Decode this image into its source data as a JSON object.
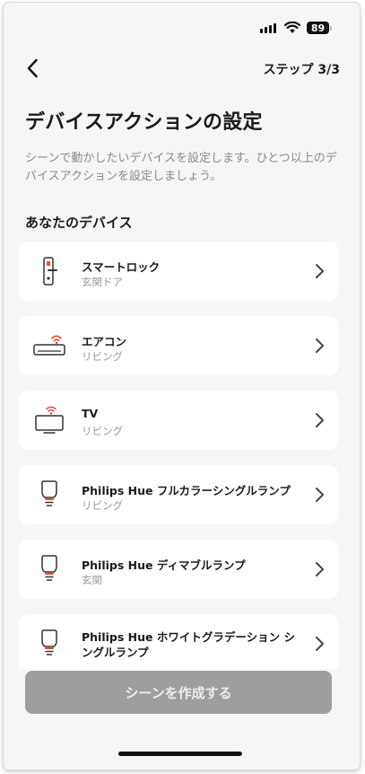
{
  "status_bar": {
    "battery_level": "89"
  },
  "header": {
    "step_label": "ステップ 3/3"
  },
  "page": {
    "title": "デバイスアクションの設定",
    "description": "シーンで動かしたいデバイスを設定します。ひとつ以上のデバイスアクションを設定しましょう。",
    "section_title": "あなたのデバイス"
  },
  "devices": [
    {
      "name": "スマートロック",
      "room": "玄関ドア",
      "icon": "smart-lock-icon"
    },
    {
      "name": "エアコン",
      "room": "リビング",
      "icon": "air-conditioner-icon"
    },
    {
      "name": "TV",
      "room": "リビング",
      "icon": "tv-icon"
    },
    {
      "name": "Philips Hue フルカラーシングルランプ",
      "room": "リビング",
      "icon": "light-bulb-icon"
    },
    {
      "name": "Philips Hue ディマブルランプ",
      "room": "玄関",
      "icon": "light-bulb-icon"
    },
    {
      "name": "Philips Hue ホワイトグラデーション シングルランプ",
      "room": "",
      "icon": "light-bulb-icon"
    }
  ],
  "footer": {
    "create_button_label": "シーンを作成する"
  },
  "colors": {
    "accent": "#e8473f",
    "disabled_button": "#9e9e9e",
    "background": "#f6f6f6"
  }
}
